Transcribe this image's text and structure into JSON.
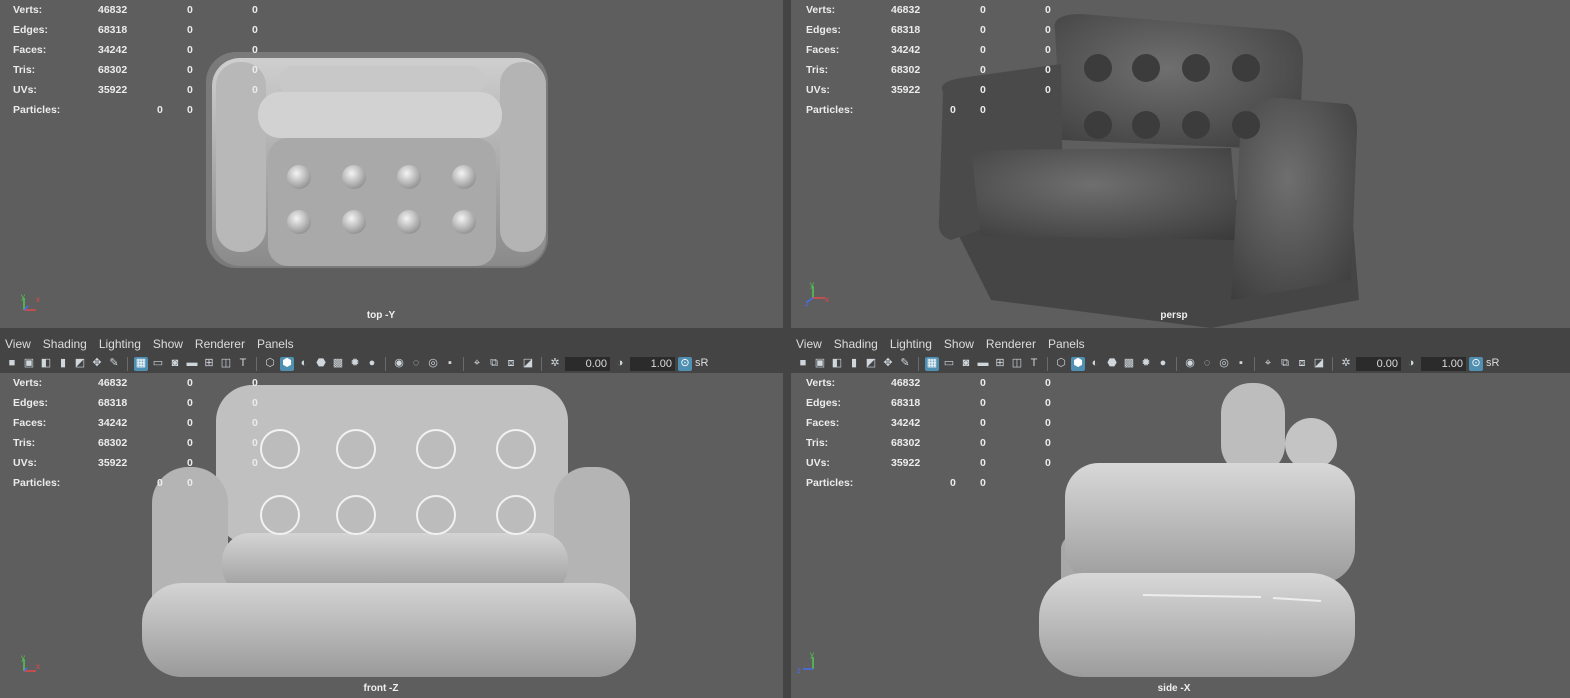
{
  "hud": {
    "verts": {
      "label": "Verts:",
      "a": "46832",
      "b": "0",
      "c": "0"
    },
    "edges": {
      "label": "Edges:",
      "a": "68318",
      "b": "0",
      "c": "0"
    },
    "faces": {
      "label": "Faces:",
      "a": "34242",
      "b": "0",
      "c": "0"
    },
    "tris": {
      "label": "Tris:",
      "a": "68302",
      "b": "0",
      "c": "0"
    },
    "uvs": {
      "label": "UVs:",
      "a": "35922",
      "b": "0",
      "c": "0"
    },
    "particles": {
      "label": "Particles:",
      "a": "0",
      "b": "0"
    }
  },
  "menu": [
    "View",
    "Shading",
    "Lighting",
    "Show",
    "Renderer",
    "Panels"
  ],
  "toolbar": {
    "exposure": "0.00",
    "gamma": "1.00",
    "colorspace": "sR"
  },
  "cameras": {
    "top": "top -Y",
    "persp": "persp",
    "front": "front -Z",
    "side": "side -X"
  },
  "axes": {
    "x": "x",
    "y": "y",
    "z": "z"
  },
  "icons": [
    "camera-icon",
    "camera-lock-icon",
    "bookmark-icon",
    "image-plane-icon",
    "grid-icon",
    "film-gate-icon",
    "resolution-gate-icon",
    "safe-action-icon",
    "field-chart-icon",
    "hud-icon",
    "wireframe-icon",
    "smooth-shade-icon",
    "shaded-wireframe-icon",
    "textured-icon",
    "lights-icon",
    "shadows-icon",
    "ambient-occlusion-icon",
    "motion-blur-icon",
    "isolate-icon",
    "xray-icon",
    "exposure-icon",
    "gamma-icon",
    "color-management-icon"
  ],
  "colors": {
    "viewport_bg": "#5e5e5e",
    "panel_bg": "#444444",
    "active_button": "#4f8fb2",
    "axis_x": "#e04848",
    "axis_y": "#50c850",
    "axis_z": "#4a6cf0"
  }
}
